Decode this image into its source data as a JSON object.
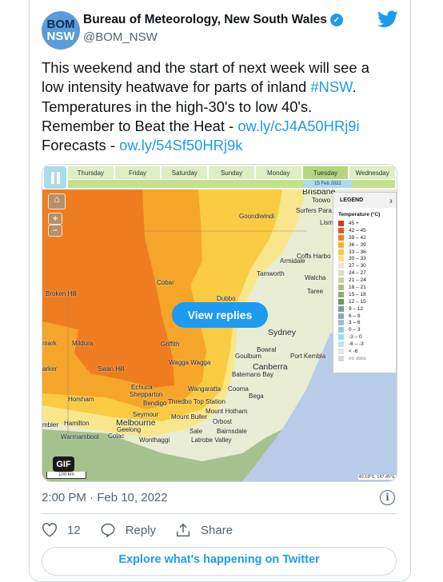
{
  "tweet": {
    "avatar_top": "BOM",
    "avatar_bottom": "NSW",
    "author_name": "Bureau of Meteorology, New South Wales",
    "handle": "@BOM_NSW",
    "verified": true,
    "text_lines": [
      "This weekend and the start of next week will see a",
      "low intensity heatwave for parts of inland ",
      "Temperatures in the high-30's to low 40's.",
      "Remember to Beat the Heat - ",
      "Forecasts - "
    ],
    "hashtag": "#NSW",
    "hashtag_suffix": ".",
    "link1": "ow.ly/cJ4A50HRj9i",
    "link2": "ow.ly/54Sf50HRj9k",
    "timestamp": "2:00 PM · Feb 10, 2022",
    "likes": "12",
    "reply_label": "Reply",
    "share_label": "Share",
    "explore_label": "Explore what's happening on Twitter",
    "brand_color": "#1d9bf0"
  },
  "media": {
    "days": [
      "Thursday",
      "Friday",
      "Saturday",
      "Sunday",
      "Monday",
      "Tuesday",
      "Wednesday"
    ],
    "selected_day": "Tuesday",
    "selected_date": "15 Feb 2022",
    "view_replies": "View replies",
    "gif_badge": "GIF",
    "scale": "100 km",
    "coords": "40.18°S, 147.45°E",
    "legend": {
      "header": "LEGEND",
      "title": "Temperature (°C)",
      "items": [
        {
          "label": "45 +",
          "color": "#c0441a"
        },
        {
          "label": "42 – 45",
          "color": "#e4571e"
        },
        {
          "label": "39 – 42",
          "color": "#ee7f24"
        },
        {
          "label": "36 – 39",
          "color": "#f6ad2a"
        },
        {
          "label": "33 – 36",
          "color": "#f8c844"
        },
        {
          "label": "30 – 33",
          "color": "#f8e28a"
        },
        {
          "label": "27 – 30",
          "color": "#e8e8c8"
        },
        {
          "label": "24 – 27",
          "color": "#d8dfc0"
        },
        {
          "label": "21 – 24",
          "color": "#c2d0a8"
        },
        {
          "label": "18 – 21",
          "color": "#a8bf8a"
        },
        {
          "label": "15 – 18",
          "color": "#8bac6c"
        },
        {
          "label": "12 – 15",
          "color": "#6f9456"
        },
        {
          "label": "9 – 12",
          "color": "#7e98a0"
        },
        {
          "label": "6 – 9",
          "color": "#8ea8b4"
        },
        {
          "label": "3 – 6",
          "color": "#a2bccb"
        },
        {
          "label": "0 – 3",
          "color": "#8ed0e0"
        },
        {
          "label": "-3 – 0",
          "color": "#9cdce6"
        },
        {
          "label": "-6 – -3",
          "color": "#bfe6ee"
        },
        {
          "label": "< -6",
          "color": "#dcecf0"
        },
        {
          "label": "no data",
          "color": "#d8d8d8"
        }
      ]
    },
    "places": [
      "Brisbane",
      "Toowo",
      "Surfers Para",
      "Goondiwindi",
      "Lism",
      "Coffs Harbo",
      "Armidale",
      "Tamworth",
      "Walcha",
      "Cobar",
      "Taree",
      "Broken Hill",
      "Dubbo",
      "Sydney",
      "mark",
      "Mildura",
      "Griffith",
      "Bowral",
      "Goulburn",
      "Port Kembla",
      "Wagga Wagga",
      "Canberra",
      "arker",
      "Swan Hill",
      "Batemans Bay",
      "Echuca",
      "Wangaratta",
      "Cooma",
      "Shepparton",
      "Bega",
      "Horsham",
      "Bendigo",
      "Thredbo Top Station",
      "Mount Hotham",
      "Seymour",
      "Mount Buller",
      "Orbost",
      "mbler",
      "Hamilton",
      "Melbourne",
      "Geelong",
      "Sale",
      "Bairnsdale",
      "Warrnambool",
      "Colac",
      "Wonthaggi",
      "Latrobe Valley"
    ]
  }
}
